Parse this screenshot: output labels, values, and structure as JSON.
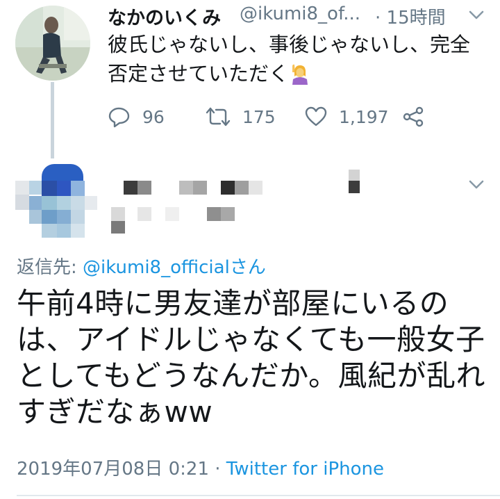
{
  "tweet": {
    "display_name": "なかのいくみ",
    "handle": "@ikumi8_of...",
    "time": "· 15時間",
    "text": "彼氏じゃないし、事後じゃないし、完全否定させていただく",
    "emoji": "woman-raising-hand-emoji",
    "stats": {
      "replies": "96",
      "retweets": "175",
      "likes": "1,197"
    }
  },
  "reply": {
    "reply_to_prefix": "返信先: ",
    "reply_to_handle": "@ikumi8_official",
    "reply_to_suffix": "さん",
    "text": "午前4時に男友達が部屋にいるのは、アイドルじゃなくても一般女子としてもどうなんだか。風紀が乱れすぎだなぁww",
    "date": "2019年07月08日 0:21",
    "separator": " · ",
    "client": "Twitter for iPhone"
  },
  "icons": [
    "reply-icon",
    "retweet-icon",
    "like-icon",
    "share-icon",
    "chevron-down-icon"
  ],
  "colors": {
    "text": "#14171a",
    "secondary": "#657786",
    "link": "#1b95e0",
    "thread_line": "#c9d4dc"
  }
}
